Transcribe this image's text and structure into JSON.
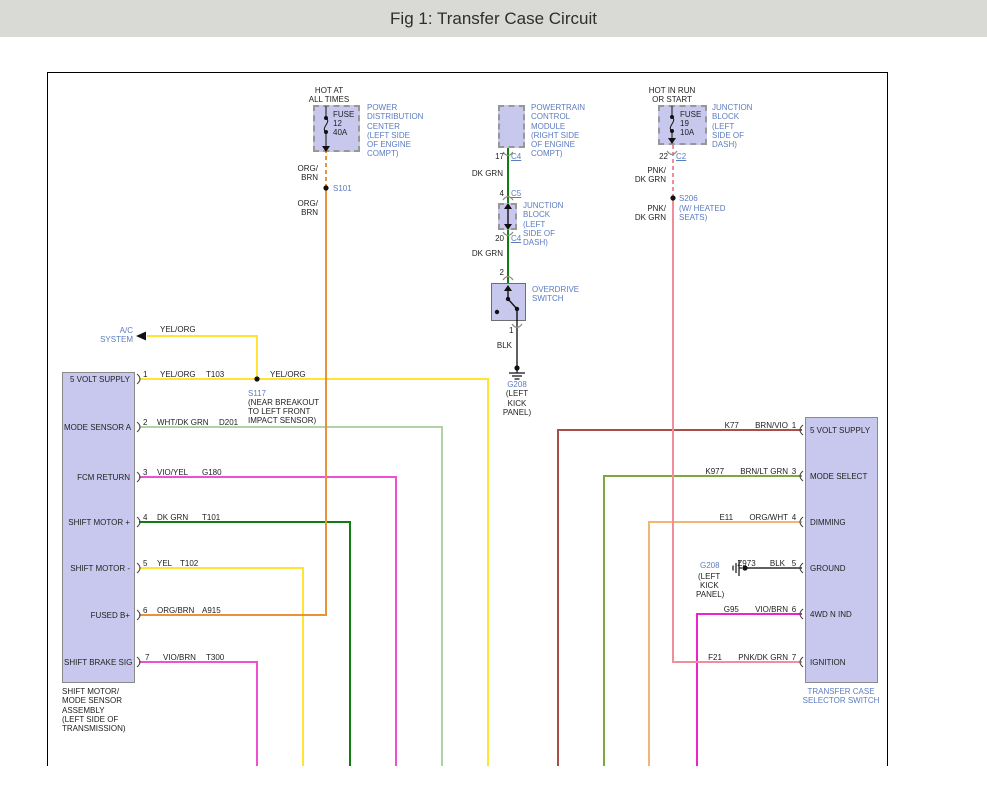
{
  "title": "Fig 1: Transfer Case Circuit",
  "colors": {
    "yellow": "#ffe431",
    "orange": "#e8923c",
    "pale_green": "#b0d2a6",
    "magenta": "#f04fd4",
    "dark_green": "#0f7d10",
    "salmon": "#f08e9b",
    "dark_red": "#a94f45",
    "olive": "#7ca93f",
    "lt_orange": "#f4b476",
    "gray_wire": "#606060",
    "bright_magenta": "#ee22cc"
  },
  "pdc": {
    "hot1": "HOT AT",
    "hot2": "ALL TIMES",
    "fuse1": "FUSE",
    "fuse2": "12",
    "fuse3": "40A",
    "label": [
      "POWER",
      "DISTRIBUTION",
      "CENTER",
      "(LEFT SIDE",
      "OF ENGINE",
      "COMPT)"
    ],
    "wire_a": "ORG/",
    "wire_b": "BRN",
    "splice": "S101",
    "wire2_a": "ORG/",
    "wire2_b": "BRN"
  },
  "pcm": {
    "label": [
      "POWERTRAIN",
      "CONTROL",
      "MODULE",
      "(RIGHT SIDE",
      "OF ENGINE",
      "COMPT)"
    ],
    "pin17": "17",
    "c4": "C4",
    "dkgrn": "DK GRN",
    "pin4": "4",
    "c5": "C5",
    "jb_label": [
      "JUNCTION",
      "BLOCK",
      "(LEFT",
      "SIDE OF",
      "DASH)"
    ],
    "pin20": "20",
    "c4b": "C4",
    "dkgrn2": "DK GRN",
    "pin2": "2",
    "sw_label": [
      "OVERDRIVE",
      "SWITCH"
    ],
    "pin1": "1",
    "blk": "BLK",
    "gnd": "G208",
    "gnd_loc": [
      "(LEFT",
      "KICK",
      "PANEL)"
    ]
  },
  "f19": {
    "hot1": "HOT IN RUN",
    "hot2": "OR START",
    "fuse1": "FUSE",
    "fuse2": "19",
    "fuse3": "10A",
    "label": [
      "JUNCTION",
      "BLOCK",
      "(LEFT",
      "SIDE OF",
      "DASH)"
    ],
    "pin22": "22",
    "c2": "C2",
    "wire1_a": "PNK/",
    "wire1_b": "DK GRN",
    "splice": "S206",
    "splice_note1": "(W/ HEATED",
    "splice_note2": "SEATS)",
    "wire2_a": "PNK/",
    "wire2_b": "DK GRN"
  },
  "ac": {
    "l1": "A/C",
    "l2": "SYSTEM",
    "wire": "YEL/ORG"
  },
  "s117": {
    "name": "S117",
    "n1": "(NEAR BREAKOUT",
    "n2": "TO LEFT FRONT",
    "n3": "IMPACT SENSOR)",
    "wire_after": "YEL/ORG"
  },
  "lb": {
    "p1": {
      "n": "1",
      "label": "5 VOLT SUPPLY",
      "wire": "YEL/ORG",
      "code": "T103"
    },
    "p2": {
      "n": "2",
      "label": "MODE SENSOR A",
      "wire": "WHT/DK GRN",
      "code": "D201"
    },
    "p3": {
      "n": "3",
      "label": "FCM RETURN",
      "wire": "VIO/YEL",
      "code": "G180"
    },
    "p4": {
      "n": "4",
      "label": "SHIFT MOTOR +",
      "wire": "DK GRN",
      "code": "T101"
    },
    "p5": {
      "n": "5",
      "label": "SHIFT MOTOR -",
      "wire": "YEL",
      "code": "T102"
    },
    "p6": {
      "n": "6",
      "label": "FUSED B+",
      "wire": "ORG/BRN",
      "code": "A915"
    },
    "p7": {
      "n": "7",
      "label": "SHIFT BRAKE SIG",
      "wire": "VIO/BRN",
      "code": "T300"
    },
    "caption": [
      "SHIFT MOTOR/",
      "MODE SENSOR",
      "ASSEMBLY",
      "(LEFT SIDE OF",
      "TRANSMISSION)"
    ]
  },
  "rb": {
    "p1": {
      "n": "1",
      "label": "5 VOLT SUPPLY",
      "code": "K77",
      "wire": "BRN/VIO"
    },
    "p3": {
      "n": "3",
      "label": "MODE SELECT",
      "code": "K977",
      "wire": "BRN/LT GRN"
    },
    "p4": {
      "n": "4",
      "label": "DIMMING",
      "code": "E11",
      "wire": "ORG/WHT"
    },
    "p5": {
      "n": "5",
      "label": "GROUND",
      "code": "Z973",
      "wire": "BLK"
    },
    "p6": {
      "n": "6",
      "label": "4WD N IND",
      "code": "G95",
      "wire": "VIO/BRN"
    },
    "p7": {
      "n": "7",
      "label": "IGNITION",
      "code": "F21",
      "wire": "PNK/DK GRN"
    },
    "gnd": "G208",
    "gnd_loc": [
      "(LEFT",
      "KICK",
      "PANEL)"
    ],
    "caption": [
      "TRANSFER CASE",
      "SELECTOR SWITCH"
    ]
  }
}
